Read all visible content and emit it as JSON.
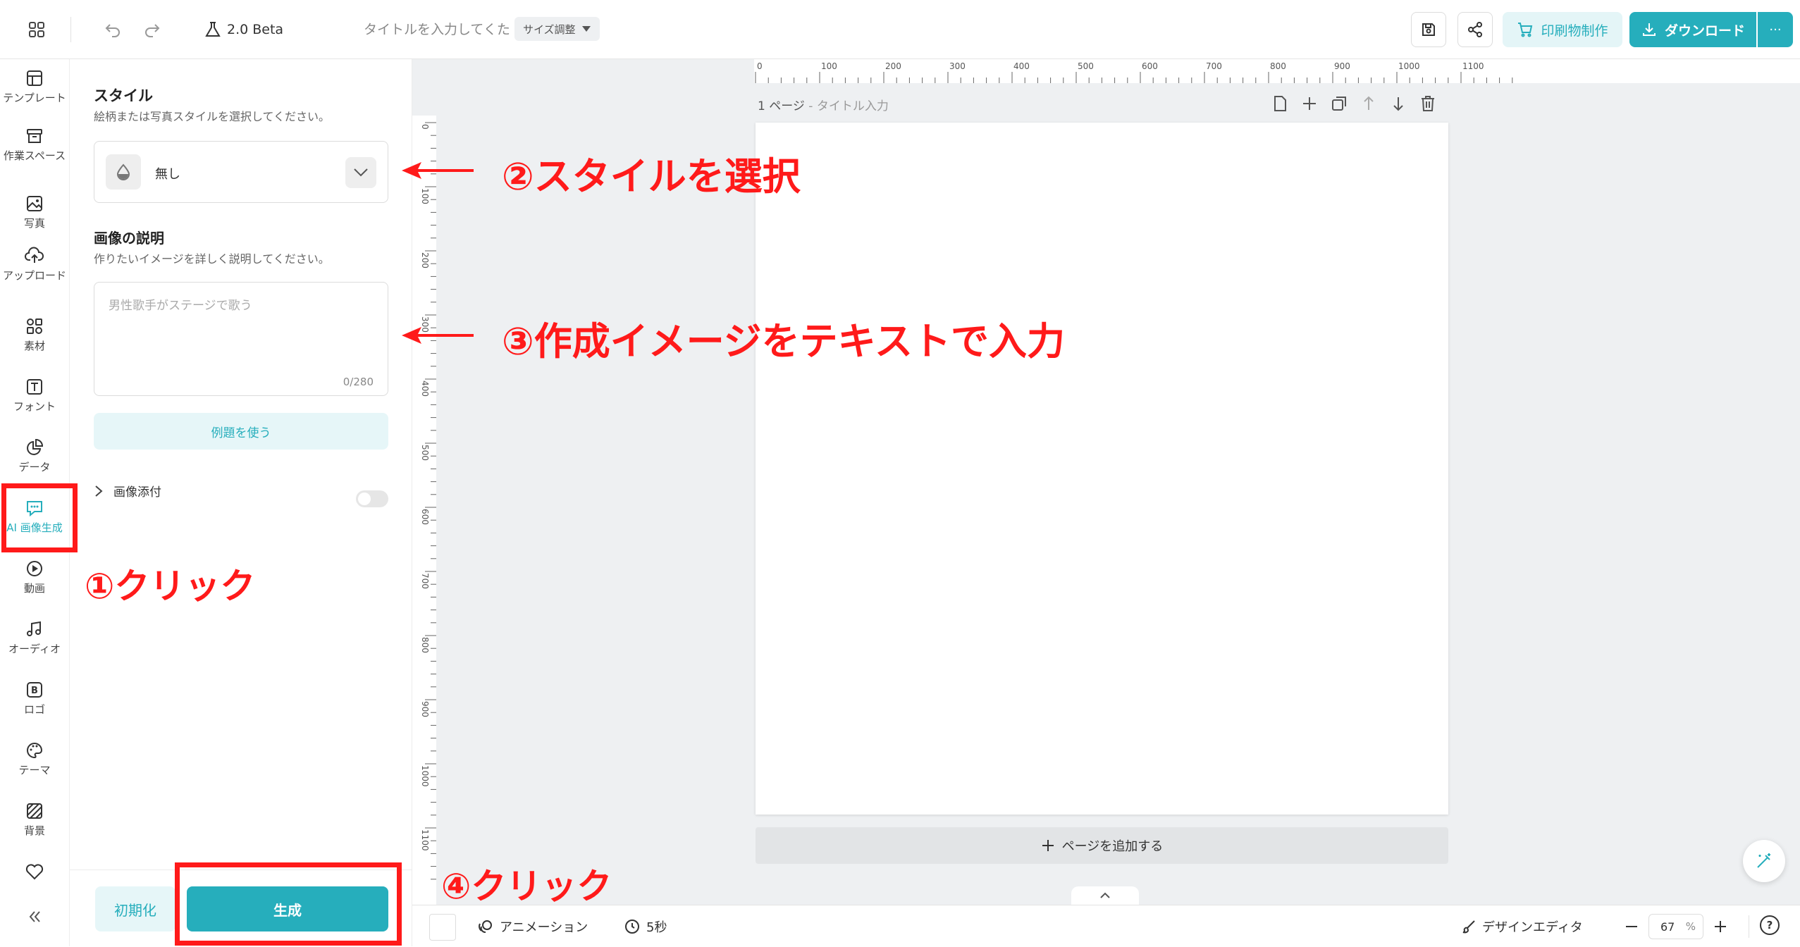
{
  "topbar": {
    "version": "2.0 Beta",
    "title_placeholder": "タイトルを入力してくた",
    "size_adjust": "サイズ調整",
    "print_button": "印刷物制作",
    "download_button": "ダウンロード",
    "more_button": "···"
  },
  "rail": {
    "items": [
      {
        "label": "テンプレート",
        "icon": "template-icon"
      },
      {
        "label": "作業スペース",
        "icon": "archive-icon"
      },
      {
        "label": "写真",
        "icon": "image-icon"
      },
      {
        "label": "アップロード",
        "icon": "upload-icon"
      },
      {
        "label": "素材",
        "icon": "elements-icon"
      },
      {
        "label": "フォント",
        "icon": "text-icon"
      },
      {
        "label": "データ",
        "icon": "chart-icon"
      },
      {
        "label": "AI 画像生成",
        "icon": "ai-chat-icon"
      },
      {
        "label": "動画",
        "icon": "play-icon"
      },
      {
        "label": "オーディオ",
        "icon": "music-icon"
      },
      {
        "label": "ロゴ",
        "icon": "logo-icon"
      },
      {
        "label": "テーマ",
        "icon": "palette-icon"
      },
      {
        "label": "背景",
        "icon": "background-icon"
      }
    ],
    "favorite_icon": "heart-icon",
    "collapse_icon": "collapse-icon"
  },
  "panel": {
    "style_heading": "スタイル",
    "style_subtext": "絵柄または写真スタイルを選択してください。",
    "style_value": "無し",
    "desc_heading": "画像の説明",
    "desc_subtext": "作りたいイメージを詳しく説明してください。",
    "desc_placeholder": "男性歌手がステージで歌う",
    "char_count": "0/280",
    "example_button": "例題を使う",
    "attach_label": "画像添付",
    "reset_button": "初期化",
    "generate_button": "生成"
  },
  "canvas": {
    "page_label": "1 ページ",
    "page_title": "- タイトル入力",
    "add_page": "ページを追加する",
    "ruler_h": [
      "0",
      "100",
      "200",
      "300",
      "400",
      "500",
      "600",
      "700",
      "800",
      "900",
      "1000",
      "1100"
    ],
    "ruler_v": [
      "0",
      "100",
      "200",
      "300",
      "400",
      "500",
      "600",
      "700",
      "800",
      "900",
      "1000",
      "1100"
    ]
  },
  "bottombar": {
    "animation": "アニメーション",
    "duration": "5秒",
    "design_editor": "デザインエディタ",
    "zoom": "67",
    "zoom_unit": "%",
    "help": "?"
  },
  "annotations": {
    "a1": "①クリック",
    "a2": "②スタイルを選択",
    "a3": "③作成イメージをテキストで入力",
    "a4": "④クリック"
  },
  "colors": {
    "accent": "#26aebc",
    "accent_light": "#e6f6f8",
    "annotation_red": "#ff1a1a"
  }
}
